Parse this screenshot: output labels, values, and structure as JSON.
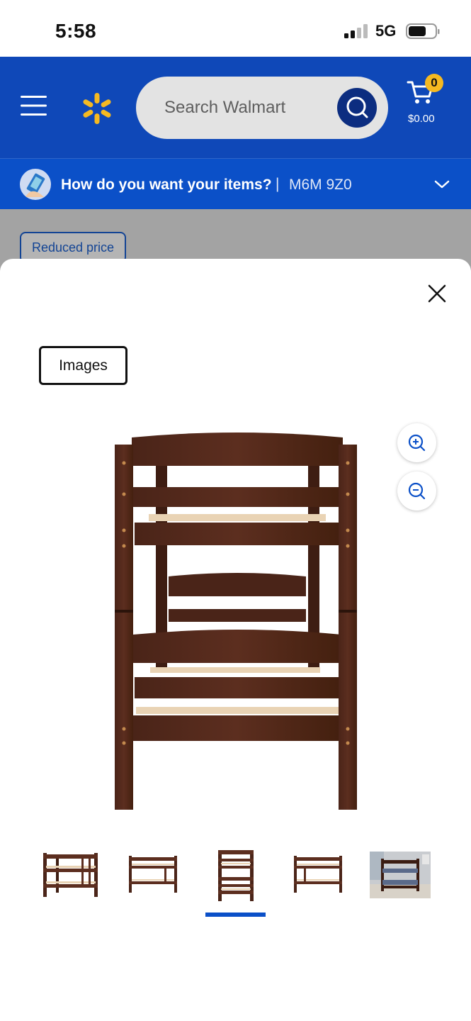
{
  "status_bar": {
    "time": "5:58",
    "network": "5G"
  },
  "header": {
    "search_placeholder": "Search Walmart",
    "cart_count": "0",
    "cart_total": "$0.00",
    "colors": {
      "brand_blue": "#0f48b8",
      "spark_yellow": "#f5b921"
    }
  },
  "fulfillment": {
    "question": "How do you want your items?",
    "separator": "|",
    "postal_code": "M6M 9Z0"
  },
  "background_page": {
    "badge": "Reduced price"
  },
  "viewer": {
    "tab_label": "Images",
    "icons": [
      "close-icon",
      "zoom-in-icon",
      "zoom-out-icon"
    ],
    "thumbnails": [
      {
        "name": "thumbnail-1",
        "active": false
      },
      {
        "name": "thumbnail-2",
        "active": false
      },
      {
        "name": "thumbnail-3",
        "active": true
      },
      {
        "name": "thumbnail-4",
        "active": false
      },
      {
        "name": "thumbnail-5",
        "active": false
      }
    ]
  }
}
